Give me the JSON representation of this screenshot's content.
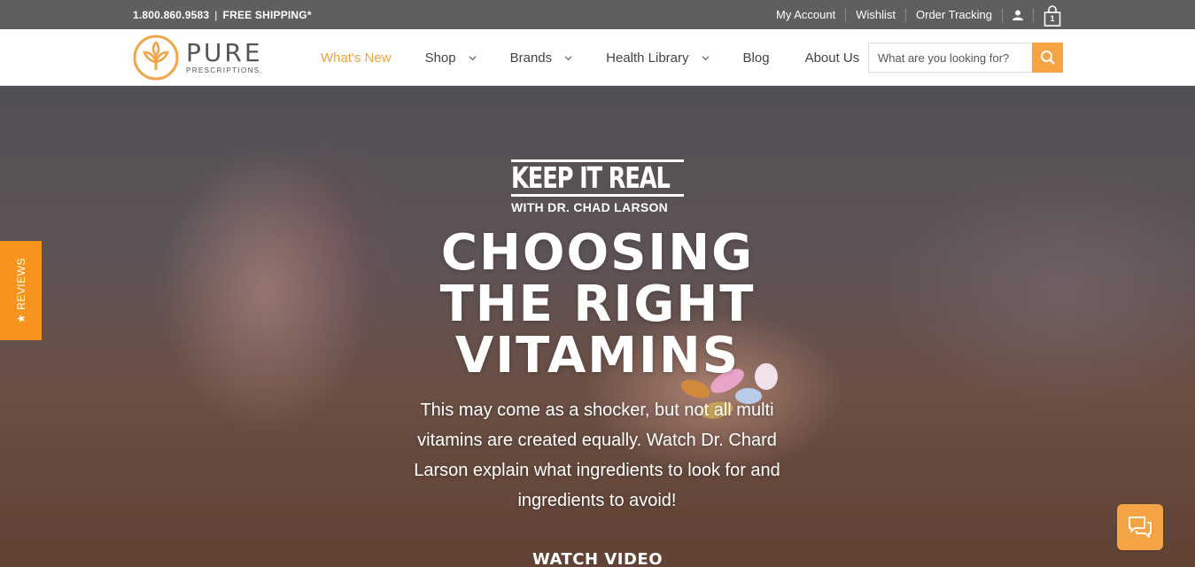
{
  "topbar": {
    "phone": "1.800.860.9583",
    "separator": "|",
    "shipping": "FREE SHIPPING*",
    "links": [
      "My Account",
      "Wishlist",
      "Order Tracking"
    ],
    "cart_count": "1"
  },
  "logo": {
    "word": "PURE",
    "sub": "PRESCRIPTIONS."
  },
  "nav": {
    "items": [
      "What's New",
      "Shop",
      "Brands",
      "Health Library",
      "Blog",
      "About Us"
    ]
  },
  "search": {
    "placeholder": "What are you looking for?"
  },
  "hero": {
    "series_title": "KEEP IT REAL",
    "series_host": "WITH DR. CHAD LARSON",
    "headline_lines": [
      "CHOOSING",
      "THE RIGHT",
      "VITAMINS"
    ],
    "description": "This may come as a shocker, but not all multi vitamins are created equally. Watch Dr. Chard Larson explain what ingredients to look for and ingredients to avoid!",
    "cta": "WATCH VIDEO"
  },
  "reviews_tab": {
    "label": "★ REVIEWS"
  },
  "colors": {
    "accent": "#f5a445",
    "topbar": "#5f5f5f",
    "reviews": "#f7941d"
  },
  "icons": {
    "search": "search-icon",
    "user": "user-icon",
    "cart": "shopping-bag-icon",
    "chat": "chat-icon",
    "logo": "leaf-logo-icon"
  }
}
